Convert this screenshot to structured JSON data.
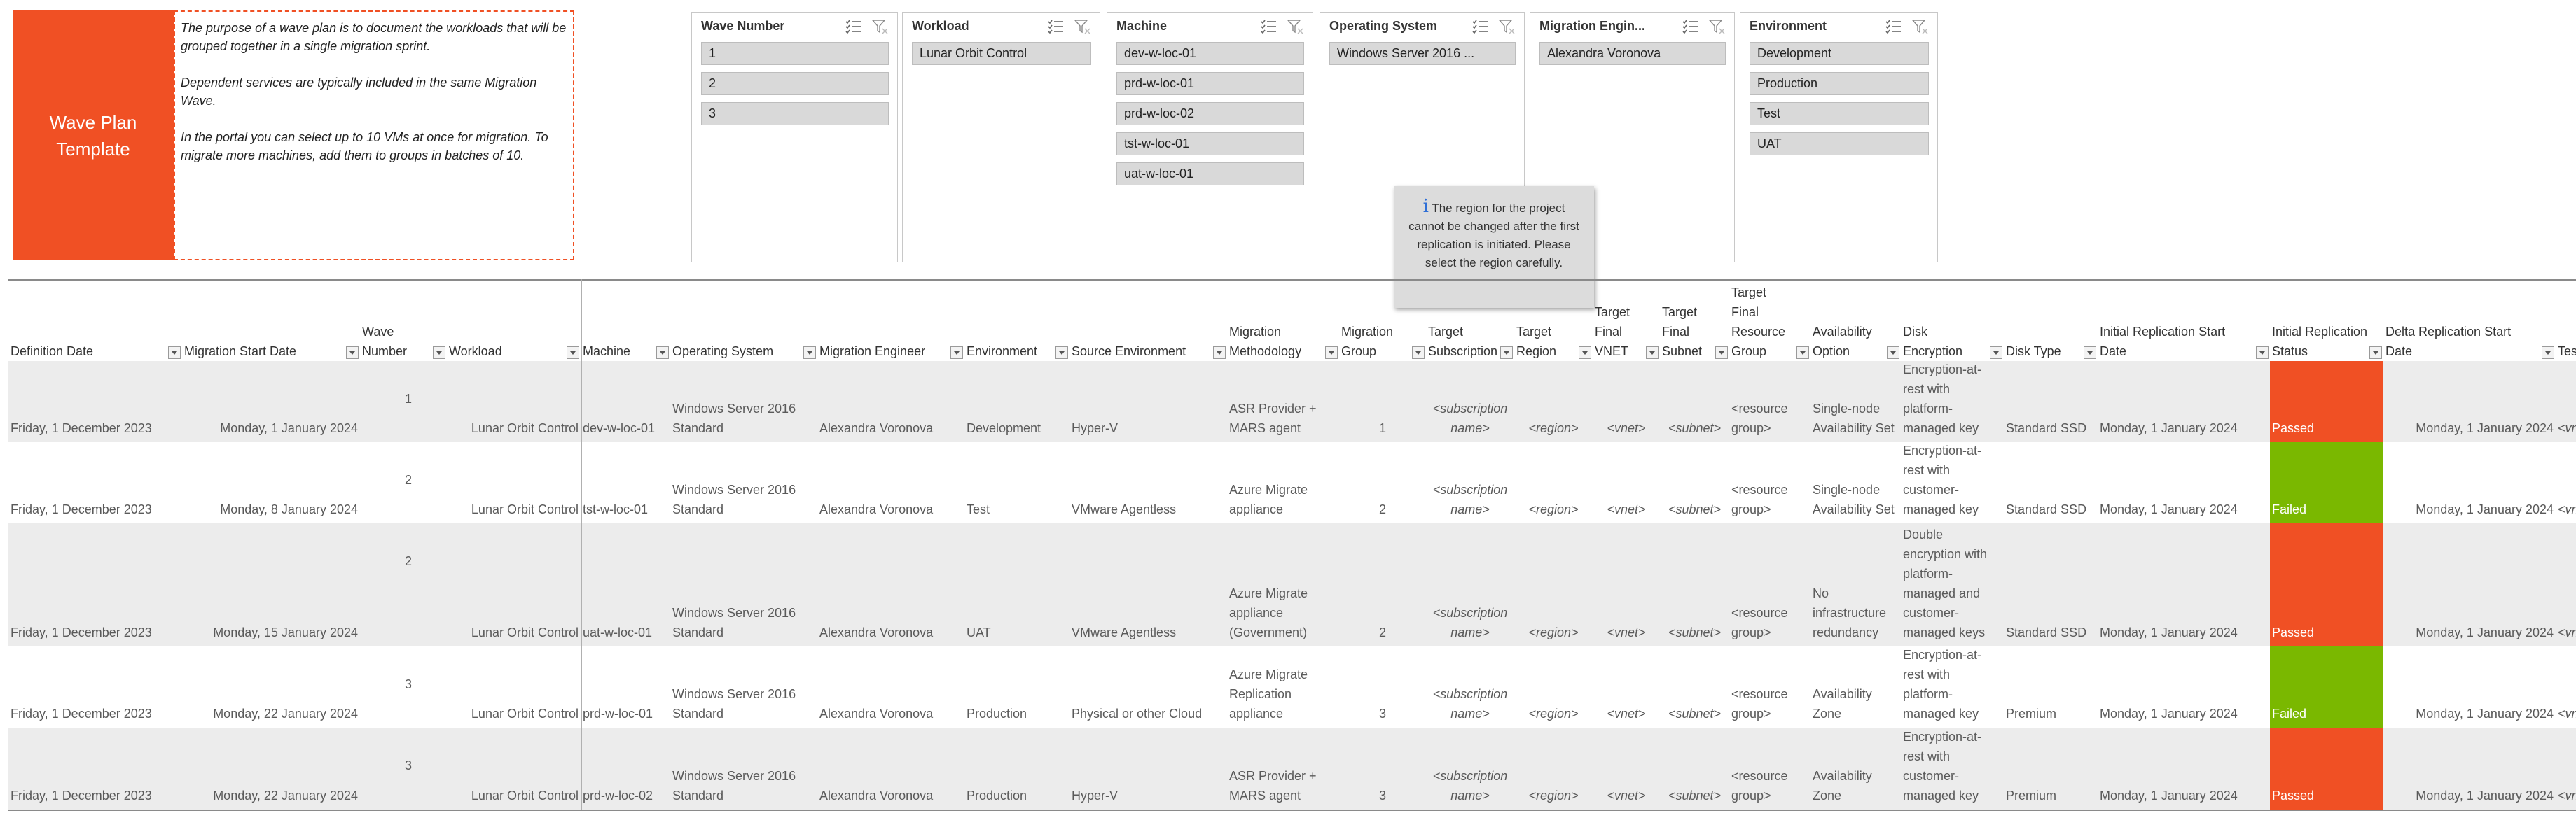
{
  "title": "Wave Plan Template",
  "description": [
    "The purpose of a wave plan is to document the workloads that will be grouped together in a single migration sprint.",
    "Dependent services are typically included in the same Migration Wave.",
    "In the portal you can select up to 10 VMs at once for migration. To migrate more machines, add them to groups in batches of 10."
  ],
  "slicers": [
    {
      "title": "Wave Number",
      "items": [
        "1",
        "2",
        "3"
      ]
    },
    {
      "title": "Workload",
      "items": [
        "Lunar Orbit Control"
      ]
    },
    {
      "title": "Machine",
      "items": [
        "dev-w-loc-01",
        "prd-w-loc-01",
        "prd-w-loc-02",
        "tst-w-loc-01",
        "uat-w-loc-01"
      ]
    },
    {
      "title": "Operating System",
      "items": [
        "Windows Server 2016 ..."
      ]
    },
    {
      "title": "Migration Engin...",
      "items": [
        "Alexandra Voronova"
      ]
    },
    {
      "title": "Environment",
      "items": [
        "Development",
        "Production",
        "Test",
        "UAT"
      ]
    }
  ],
  "tooltip": {
    "icon": "info-icon",
    "text": "The region for the project cannot be changed after the first replication is initiated. Please select the region carefully."
  },
  "columns": [
    "Definition Date",
    "Migration Start Date",
    "Wave Number",
    "Workload",
    "Machine",
    "Operating System",
    "Migration Engineer",
    "Environment",
    "Source Environment",
    "Migration Methodology",
    "Migration Group",
    "Target Subscription",
    "Target Region",
    "Target Final VNET",
    "Target Final Subnet",
    "Target Final Resource Group",
    "Availability Option",
    "Disk Encryption",
    "Disk Type",
    "Initial Replication Start Date",
    "Initial Replication Status",
    "Delta Replication Start Date",
    "Tes"
  ],
  "rows": [
    {
      "definition_date": "Friday, 1 December 2023",
      "start_date": "Monday, 1 January 2024",
      "wave": "1",
      "workload": "Lunar Orbit Control",
      "machine": "dev-w-loc-01",
      "os": "Windows Server 2016 Standard",
      "engineer": "Alexandra Voronova",
      "environment": "Development",
      "source": "Hyper-V",
      "methodology": "ASR Provider + MARS agent",
      "group": "1",
      "subscription": "<subscription name>",
      "region": "<region>",
      "vnet": "<vnet>",
      "subnet": "<subnet>",
      "resource_group": "<resource group>",
      "availability": "Single-node Availability Set",
      "encryption": "Encryption-at-rest with platform-managed key",
      "disk_type": "Standard SSD",
      "init_start": "Monday, 1 January 2024",
      "init_status": "Passed",
      "status_color": "#f05024",
      "delta_start": "Monday, 1 January 2024",
      "tes": "<vn"
    },
    {
      "definition_date": "Friday, 1 December 2023",
      "start_date": "Monday, 8 January 2024",
      "wave": "2",
      "workload": "Lunar Orbit Control",
      "machine": "tst-w-loc-01",
      "os": "Windows Server 2016 Standard",
      "engineer": "Alexandra Voronova",
      "environment": "Test",
      "source": "VMware Agentless",
      "methodology": "Azure Migrate appliance",
      "group": "2",
      "subscription": "<subscription name>",
      "region": "<region>",
      "vnet": "<vnet>",
      "subnet": "<subnet>",
      "resource_group": "<resource group>",
      "availability": "Single-node Availability Set",
      "encryption": "Encryption-at-rest with customer-managed key",
      "disk_type": "Standard SSD",
      "init_start": "Monday, 1 January 2024",
      "init_status": "Failed",
      "status_color": "#7ab800",
      "delta_start": "Monday, 1 January 2024",
      "tes": "<vn"
    },
    {
      "definition_date": "Friday, 1 December 2023",
      "start_date": "Monday, 15 January 2024",
      "wave": "2",
      "workload": "Lunar Orbit Control",
      "machine": "uat-w-loc-01",
      "os": "Windows Server 2016 Standard",
      "engineer": "Alexandra Voronova",
      "environment": "UAT",
      "source": "VMware Agentless",
      "methodology": "Azure Migrate appliance (Government)",
      "group": "2",
      "subscription": "<subscription name>",
      "region": "<region>",
      "vnet": "<vnet>",
      "subnet": "<subnet>",
      "resource_group": "<resource group>",
      "availability": "No infrastructure redundancy",
      "encryption": "Double encryption with platform-managed and customer-managed keys",
      "disk_type": "Standard SSD",
      "init_start": "Monday, 1 January 2024",
      "init_status": "Passed",
      "status_color": "#f05024",
      "delta_start": "Monday, 1 January 2024",
      "tes": "<vn"
    },
    {
      "definition_date": "Friday, 1 December 2023",
      "start_date": "Monday, 22 January 2024",
      "wave": "3",
      "workload": "Lunar Orbit Control",
      "machine": "prd-w-loc-01",
      "os": "Windows Server 2016 Standard",
      "engineer": "Alexandra Voronova",
      "environment": "Production",
      "source": "Physical or other Cloud",
      "methodology": "Azure Migrate Replication appliance",
      "group": "3",
      "subscription": "<subscription name>",
      "region": "<region>",
      "vnet": "<vnet>",
      "subnet": "<subnet>",
      "resource_group": "<resource group>",
      "availability": "Availability Zone",
      "encryption": "Encryption-at-rest with platform-managed key",
      "disk_type": "Premium",
      "init_start": "Monday, 1 January 2024",
      "init_status": "Failed",
      "status_color": "#7ab800",
      "delta_start": "Monday, 1 January 2024",
      "tes": "<vn"
    },
    {
      "definition_date": "Friday, 1 December 2023",
      "start_date": "Monday, 22 January 2024",
      "wave": "3",
      "workload": "Lunar Orbit Control",
      "machine": "prd-w-loc-02",
      "os": "Windows Server 2016 Standard",
      "engineer": "Alexandra Voronova",
      "environment": "Production",
      "source": "Hyper-V",
      "methodology": "ASR Provider + MARS agent",
      "group": "3",
      "subscription": "<subscription name>",
      "region": "<region>",
      "vnet": "<vnet>",
      "subnet": "<subnet>",
      "resource_group": "<resource group>",
      "availability": "Availability Zone",
      "encryption": "Encryption-at-rest with customer-managed key",
      "disk_type": "Premium",
      "init_start": "Monday, 1 January 2024",
      "init_status": "Passed",
      "status_color": "#f05024",
      "delta_start": "Monday, 1 January 2024",
      "tes": "<vn"
    }
  ]
}
